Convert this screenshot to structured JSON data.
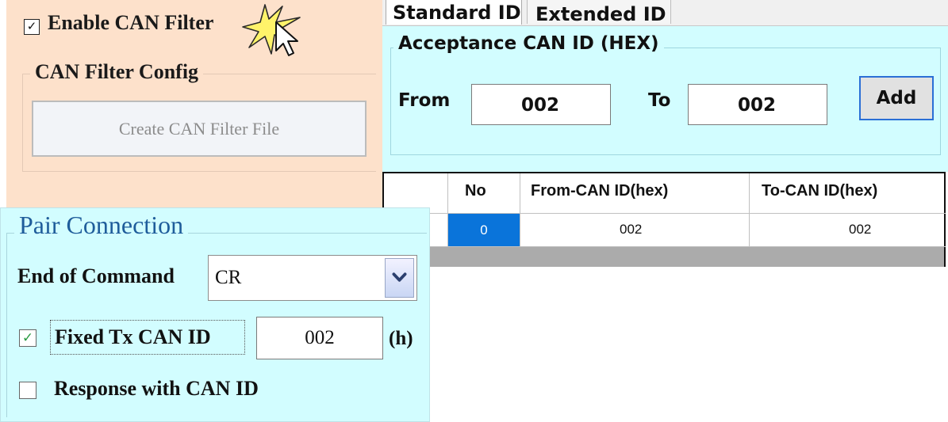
{
  "can_filter": {
    "enable_checked": true,
    "enable_label": "Enable CAN Filter",
    "group_title": "CAN Filter Config",
    "create_button": "Create CAN Filter File"
  },
  "tabs": [
    {
      "label": "Standard ID",
      "active": true
    },
    {
      "label": "Extended ID",
      "active": false
    }
  ],
  "acceptance": {
    "title": "Acceptance CAN ID (HEX)",
    "from_label": "From",
    "from_value": "002",
    "to_label": "To",
    "to_value": "002",
    "add_button": "Add"
  },
  "filter_table": {
    "columns": [
      "",
      "No",
      "From-CAN ID(hex)",
      "To-CAN ID(hex)"
    ],
    "rows": [
      {
        "no": "0",
        "from": "002",
        "to": "002"
      }
    ]
  },
  "pair_connection": {
    "title": "Pair Connection",
    "end_of_command_label": "End of Command",
    "end_of_command_value": "CR",
    "fixed_tx_checked": true,
    "fixed_tx_label": "Fixed Tx CAN ID",
    "fixed_tx_value": "002",
    "fixed_tx_suffix": "(h)",
    "response_checked": false,
    "response_label": "Response with CAN ID"
  },
  "colors": {
    "peach_panel": "#fde1cb",
    "cyan_panel": "#d2fdff",
    "selected_cell": "#0a74da",
    "pair_title": "#1f5d9b"
  },
  "icons": [
    "check-icon",
    "click-star-icon",
    "cursor-arrow-icon",
    "dropdown-arrow-icon"
  ]
}
